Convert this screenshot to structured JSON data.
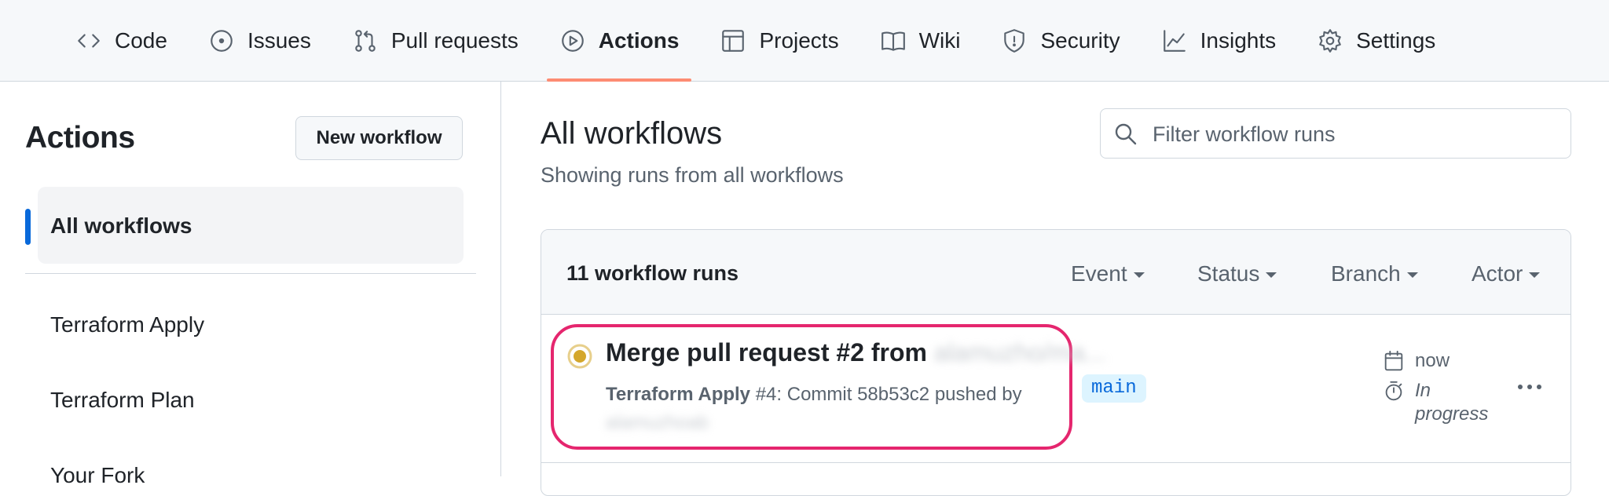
{
  "repo_nav": {
    "tabs": [
      {
        "label": "Code",
        "icon": "code-icon"
      },
      {
        "label": "Issues",
        "icon": "issue-icon"
      },
      {
        "label": "Pull requests",
        "icon": "pull-request-icon"
      },
      {
        "label": "Actions",
        "icon": "play-icon",
        "active": true
      },
      {
        "label": "Projects",
        "icon": "table-icon"
      },
      {
        "label": "Wiki",
        "icon": "book-icon"
      },
      {
        "label": "Security",
        "icon": "shield-icon"
      },
      {
        "label": "Insights",
        "icon": "graph-icon"
      },
      {
        "label": "Settings",
        "icon": "gear-icon"
      }
    ]
  },
  "sidebar": {
    "title": "Actions",
    "new_workflow_label": "New workflow",
    "selected_label": "All workflows",
    "workflows": [
      "Terraform Apply",
      "Terraform Plan",
      "Your Fork"
    ]
  },
  "main": {
    "title": "All workflows",
    "subtitle": "Showing runs from all workflows",
    "filter_placeholder": "Filter workflow runs",
    "runs_count": "11 workflow runs",
    "filters": [
      "Event",
      "Status",
      "Branch",
      "Actor"
    ],
    "runs": [
      {
        "title": "Merge pull request #2 from",
        "title_redacted": "alamuzho/ma...",
        "workflow": "Terraform Apply",
        "meta_rest": " #4: Commit 58b53c2 pushed by",
        "actor_redacted": "alamuzhoab",
        "branch": "main",
        "time": "now",
        "duration": "In progress",
        "status": "in_progress"
      }
    ]
  },
  "colors": {
    "accent_tab_underline": "#fd8c73",
    "selected_bar": "#0969da",
    "highlight_border": "#e5266e",
    "in_progress": "#d4a72c",
    "branch_bg": "#ddf4ff"
  }
}
